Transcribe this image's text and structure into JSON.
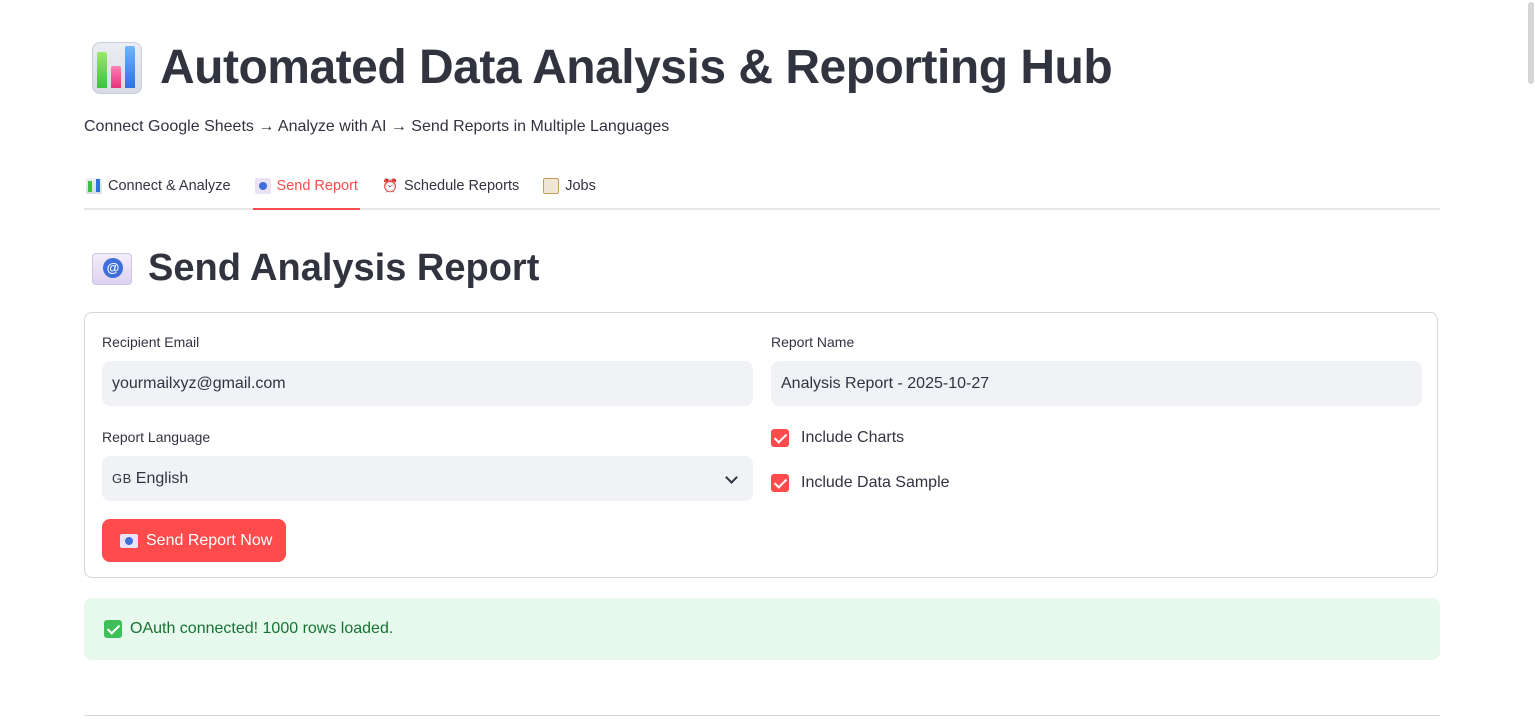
{
  "header": {
    "title": "Automated Data Analysis & Reporting Hub",
    "title_icon": "bar-chart-emoji",
    "subtitle": "Connect Google Sheets → Analyze with AI → Send Reports in Multiple Languages"
  },
  "tabs": [
    {
      "label": "Connect & Analyze",
      "icon": "bar-chart-icon",
      "active": false
    },
    {
      "label": "Send Report",
      "icon": "mail-icon",
      "active": true
    },
    {
      "label": "Schedule Reports",
      "icon": "alarm-clock-icon",
      "active": false
    },
    {
      "label": "Jobs",
      "icon": "clipboard-icon",
      "active": false
    }
  ],
  "section": {
    "title": "Send Analysis Report",
    "icon": "email-icon"
  },
  "form": {
    "recipient_label": "Recipient Email",
    "recipient_value": "yourmailxyz@gmail.com",
    "report_name_label": "Report Name",
    "report_name_value": "Analysis Report - 2025-10-27",
    "language_label": "Report Language",
    "language_flag": "GB",
    "language_value": "English",
    "include_charts_label": "Include Charts",
    "include_charts_checked": true,
    "include_data_sample_label": "Include Data Sample",
    "include_data_sample_checked": true,
    "send_button_label": "Send Report Now"
  },
  "alert": {
    "message": "OAuth connected! 1000 rows loaded.",
    "type": "success"
  },
  "colors": {
    "primary": "#ff4b4b",
    "text": "#31333f",
    "input_bg": "#f0f2f6",
    "success_bg": "#e6f9ec",
    "success_text": "#177233"
  }
}
